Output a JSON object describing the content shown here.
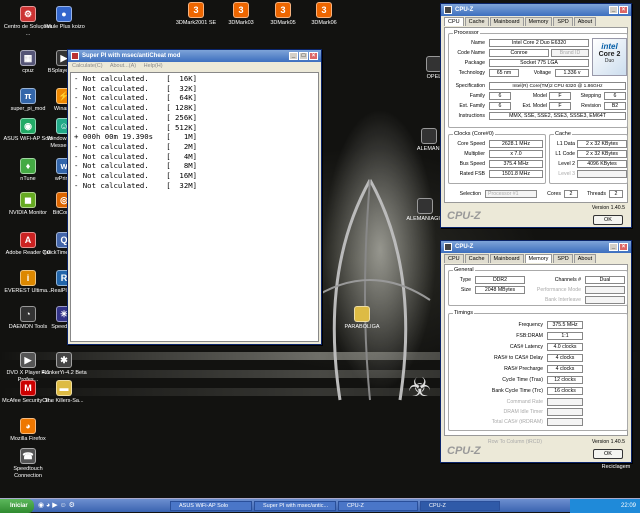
{
  "desktop": {
    "icons": [
      {
        "label": "Centro de Soluções ...",
        "glyph": "⚙",
        "color": "#c33"
      },
      {
        "label": "cpuz",
        "glyph": "▦",
        "color": "#557"
      },
      {
        "label": "super_pi_mod",
        "glyph": "π",
        "color": "#36a"
      },
      {
        "label": "ASUS WiFi-AP Solo",
        "glyph": "◉",
        "color": "#2a6"
      },
      {
        "label": "nTune",
        "glyph": "♦",
        "color": "#4a4"
      },
      {
        "label": "NVIDIA Monitor",
        "glyph": "◼",
        "color": "#6a2"
      },
      {
        "label": "Adobe Reader 7.0",
        "glyph": "A",
        "color": "#c22"
      },
      {
        "label": "EVEREST Ultima...",
        "glyph": "i",
        "color": "#d80"
      },
      {
        "label": "DAEMON Tools",
        "glyph": "◔",
        "color": "#333"
      },
      {
        "label": "DVD X Player 4.1 Profes...",
        "glyph": "▶",
        "color": "#555"
      },
      {
        "label": "McAfee SecurityCe...",
        "glyph": "M",
        "color": "#c00"
      },
      {
        "label": "Mozilla Firefox",
        "glyph": "◕",
        "color": "#e70"
      },
      {
        "label": "Speedtouch Connection",
        "glyph": "☎",
        "color": "#555"
      },
      {
        "label": "eMule Plus koizo",
        "glyph": "●",
        "color": "#36c"
      },
      {
        "label": "BSplayer Pro",
        "glyph": "▶",
        "color": "#333"
      },
      {
        "label": "Winamp",
        "glyph": "⚡",
        "color": "#e80"
      },
      {
        "label": "Windows Live Messenger",
        "glyph": "☺",
        "color": "#2a8"
      },
      {
        "label": "wPrime",
        "glyph": "w",
        "color": "#36a"
      },
      {
        "label": "BitComet",
        "glyph": "◎",
        "color": "#d60"
      },
      {
        "label": "QuickTime Player",
        "glyph": "Q",
        "color": "#46a"
      },
      {
        "label": "RealPlayer",
        "glyph": "R",
        "color": "#26a"
      },
      {
        "label": "SpeedFan",
        "glyph": "✳",
        "color": "#338"
      },
      {
        "label": "FlonkerYi-4.2 Beta",
        "glyph": "✱",
        "color": "#444"
      },
      {
        "label": "The Killers-Sa...",
        "glyph": "▬",
        "color": "#db4"
      },
      {
        "label": "3DMark2001 SE",
        "glyph": "3",
        "color": "#e60"
      },
      {
        "label": "3DMark03",
        "glyph": "3",
        "color": "#e60"
      },
      {
        "label": "3DMark05",
        "glyph": "3",
        "color": "#e60"
      },
      {
        "label": "3DMark06",
        "glyph": "3",
        "color": "#e60"
      },
      {
        "label": "OPEL",
        "glyph": "",
        "color": "#333"
      },
      {
        "label": "ALEMANI",
        "glyph": "",
        "color": "#333"
      },
      {
        "label": "ALEMANIAGIA",
        "glyph": "",
        "color": "#333"
      },
      {
        "label": "PARABOLIGA",
        "glyph": "",
        "color": "#db4"
      },
      {
        "label": "Reciclagem",
        "glyph": "♻",
        "color": "#888"
      }
    ]
  },
  "superpi": {
    "title": "Super PI with msec/antiCheat mod",
    "menu": [
      "Calculate(C)",
      "About...(A)",
      "Help(H)"
    ],
    "lines": [
      "- Not calculated.    [  16K]",
      "- Not calculated.    [  32K]",
      "- Not calculated.    [  64K]",
      "- Not calculated.    [ 128K]",
      "- Not calculated.    [ 256K]",
      "- Not calculated.    [ 512K]",
      "+ 000h 00m 19.390s   [   1M]",
      "- Not calculated.    [   2M]",
      "- Not calculated.    [   4M]",
      "- Not calculated.    [   8M]",
      "- Not calculated.    [  16M]",
      "- Not calculated.    [  32M]"
    ]
  },
  "cpuz1": {
    "title": "CPU-Z",
    "tabs": [
      "CPU",
      "Cache",
      "Mainboard",
      "Memory",
      "SPD",
      "About"
    ],
    "processor_label": "Processor",
    "name_label": "Name",
    "name": "Intel Core 2 Duo E6320",
    "codename_label": "Code Name",
    "codename": "Conroe",
    "brandid": "Brand ID",
    "package_label": "Package",
    "package": "Socket 775 LGA",
    "technology_label": "Technology",
    "technology": "65 nm",
    "voltage_label": "Voltage",
    "voltage": "1.336 v",
    "spec_label": "Specification",
    "spec": "Intel(R) Core(TM)2 CPU        6320  @ 1.86GHz",
    "family_label": "Family",
    "family": "6",
    "model_label": "Model",
    "model": "F",
    "stepping_label": "Stepping",
    "stepping": "6",
    "extfamily_label": "Ext. Family",
    "extfamily": "6",
    "extmodel_label": "Ext. Model",
    "extmodel": "F",
    "revision_label": "Revision",
    "revision": "B2",
    "instructions_label": "Instructions",
    "instructions": "MMX, SSE, SSE2, SSE3, SSSE3, EM64T",
    "clocks_label": "Clocks (Core#0)",
    "corespeed_label": "Core Speed",
    "corespeed": "2628.1 MHz",
    "multiplier_label": "Multiplier",
    "multiplier": "x 7.0",
    "busspeed_label": "Bus Speed",
    "busspeed": "375.4 MHz",
    "ratedfsb_label": "Rated FSB",
    "ratedfsb": "1501.8 MHz",
    "cache_label": "Cache",
    "l1data_label": "L1 Data",
    "l1data": "2 x 32 KBytes",
    "l1code_label": "L1 Code",
    "l1code": "2 x 32 KBytes",
    "level2_label": "Level 2",
    "level2": "4096 KBytes",
    "level3_label": "Level 3",
    "selection_label": "Selection",
    "selection": "Processor #1",
    "cores_label": "Cores",
    "cores": "2",
    "threads_label": "Threads",
    "threads": "2",
    "version": "Version 1.40.5",
    "ok": "OK",
    "logo": "CPU-Z",
    "intel_core": "Core 2",
    "intel_duo": "Duo",
    "intel_inside": "intel"
  },
  "cpuz2": {
    "title": "CPU-Z",
    "tabs": [
      "CPU",
      "Cache",
      "Mainboard",
      "Memory",
      "SPD",
      "About"
    ],
    "general_label": "General",
    "type_label": "Type",
    "type": "DDR2",
    "size_label": "Size",
    "size": "2048 MBytes",
    "channels_label": "Channels #",
    "channels": "Dual",
    "perfmode_label": "Performance Mode",
    "bankint_label": "Bank Interleave",
    "timings_label": "Timings",
    "freq_label": "Frequency",
    "freq": "375.5 MHz",
    "fsbdram_label": "FSB:DRAM",
    "fsbdram": "1:1",
    "cas_label": "CAS# Latency",
    "cas": "4.0 clocks",
    "rcd_label": "RAS# to CAS# Delay",
    "rcd": "4 clocks",
    "rp_label": "RAS# Precharge",
    "rp": "4 clocks",
    "tras_label": "Cycle Time (Tras)",
    "tras": "12 clocks",
    "trc_label": "Bank Cycle Time (Trc)",
    "trc": "16 clocks",
    "cr_label": "Command Rate",
    "idle_label": "DRAM Idle Timer",
    "trdram_label": "Total CAS# (tRDRAM)",
    "trcd_label": "Row To Column (tRCD)",
    "version": "Version 1.40.5",
    "ok": "OK",
    "logo": "CPU-Z"
  },
  "taskbar": {
    "start": "Iniciar",
    "tasks": [
      "ASUS WiFi-AP Solo",
      "Super PI with msec/antic...",
      "CPU-Z",
      "CPU-Z"
    ],
    "clock": "22:09"
  }
}
